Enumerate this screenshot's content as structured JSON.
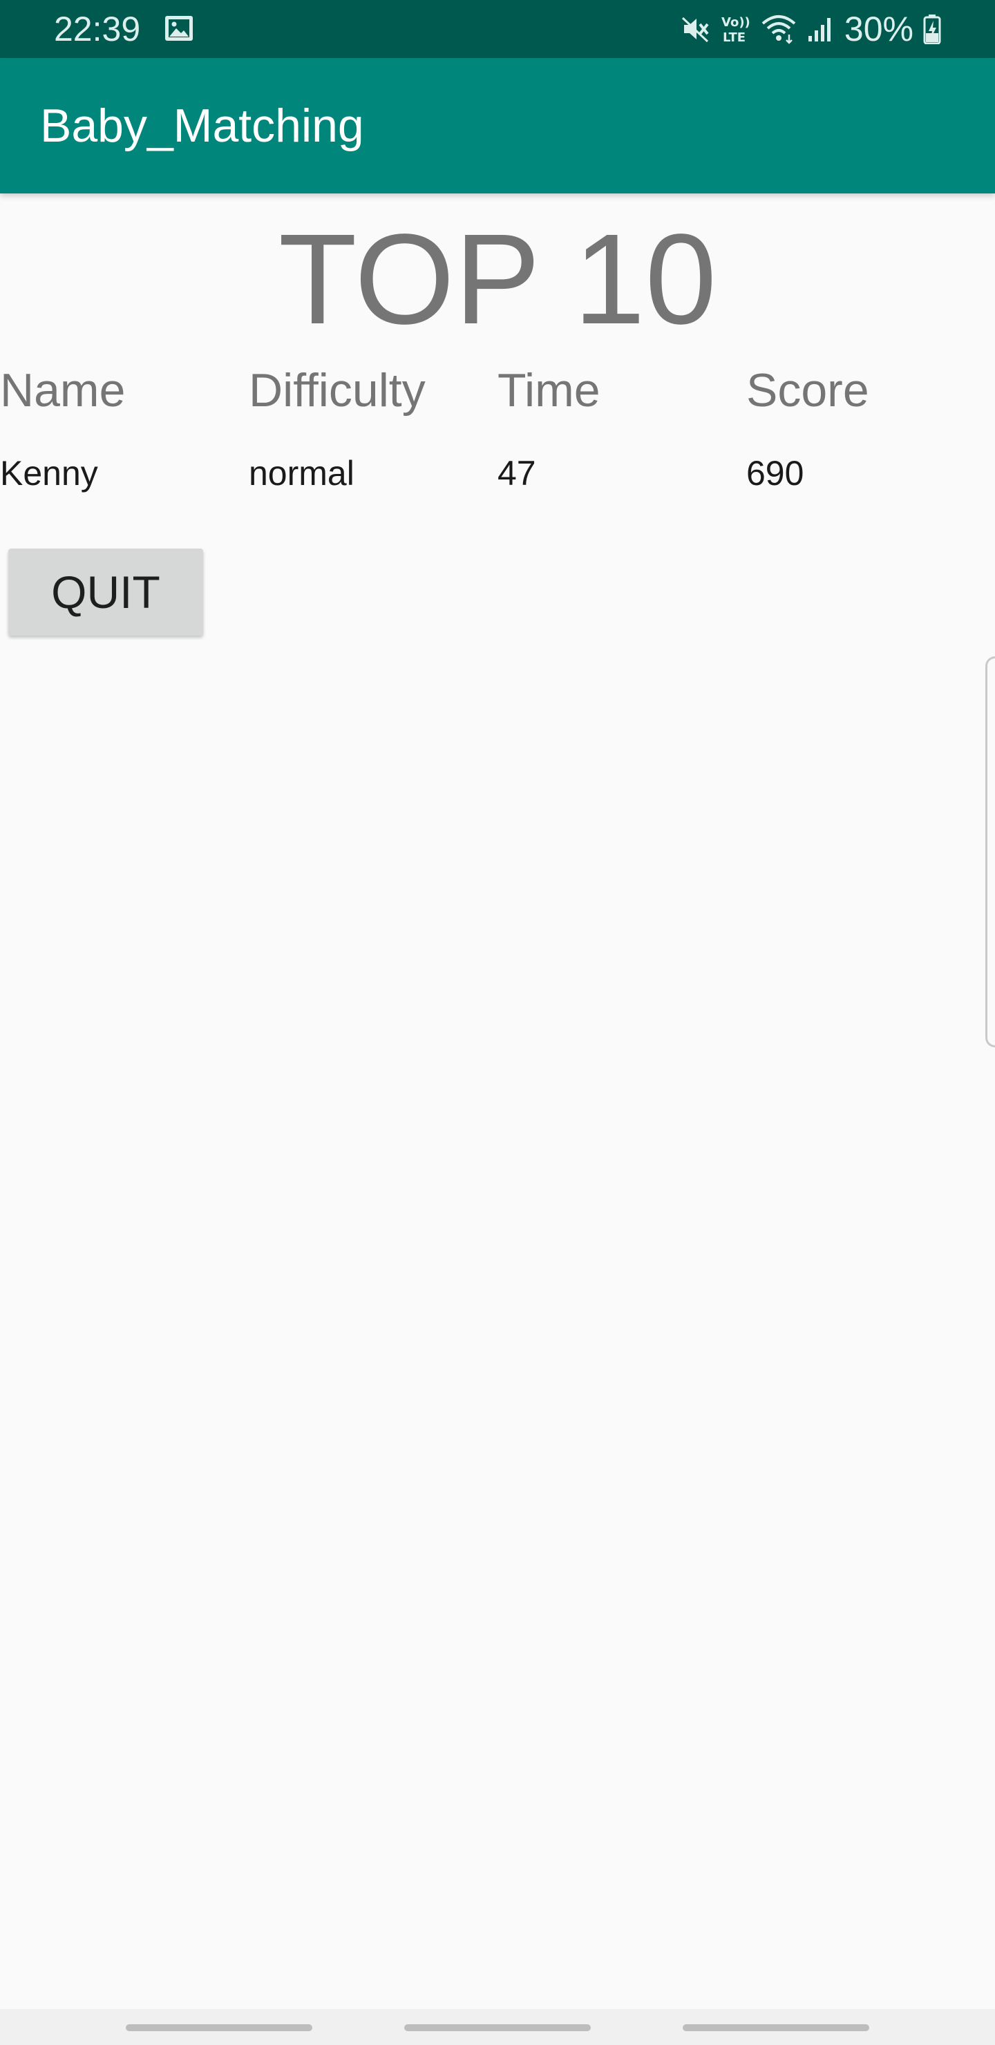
{
  "status_bar": {
    "time": "22:39",
    "battery": "30%",
    "icons": [
      "gallery-icon",
      "mute-icon",
      "volte-icon",
      "wifi-icon",
      "signal-icon",
      "battery-charging-icon"
    ]
  },
  "app_bar": {
    "title": "Baby_Matching"
  },
  "leaderboard": {
    "title": "TOP 10",
    "columns": [
      "Name",
      "Difficulty",
      "Time",
      "Score"
    ],
    "rows": [
      {
        "name": "Kenny",
        "difficulty": "normal",
        "time": "47",
        "score": "690"
      }
    ]
  },
  "actions": {
    "quit_label": "QUIT"
  },
  "colors": {
    "status_bar": "#00594f",
    "app_bar": "#00867a",
    "background": "#fafafa",
    "header_text": "#757575",
    "button": "#d6d7d7"
  }
}
